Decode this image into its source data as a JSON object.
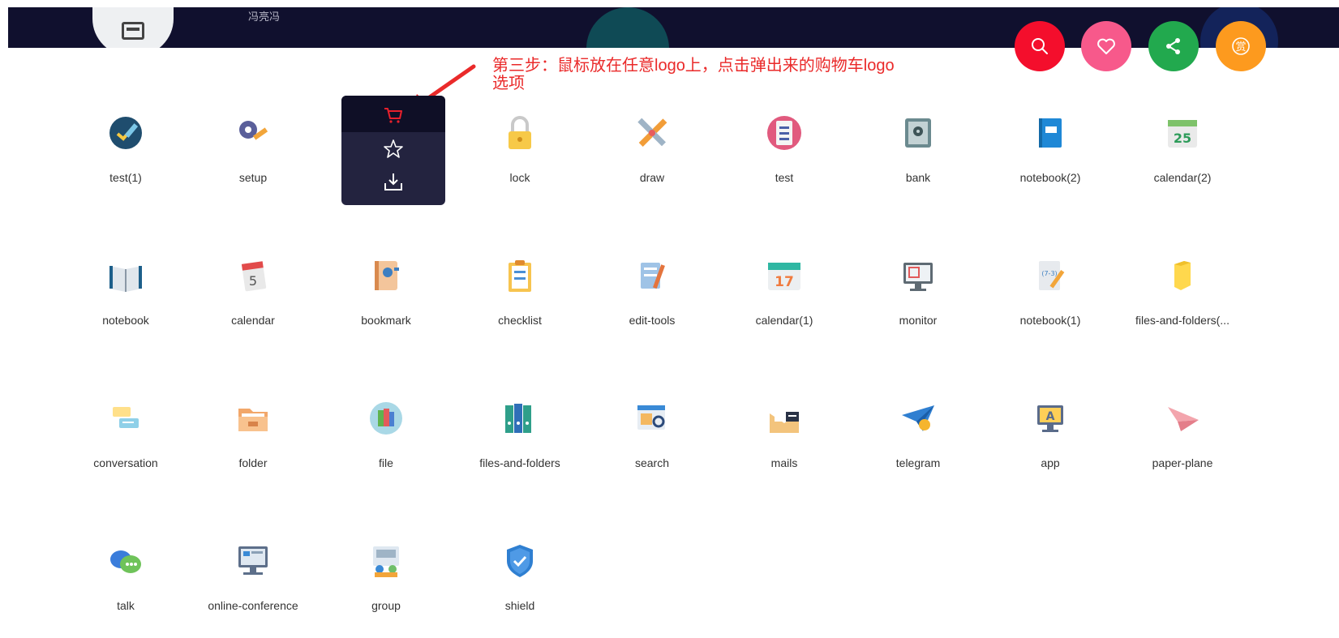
{
  "header": {
    "username": "冯亮冯"
  },
  "actions": [
    {
      "name": "search",
      "icon": "search-icon",
      "color": "#f40e2c"
    },
    {
      "name": "favorite",
      "icon": "heart-icon",
      "color": "#f7598b"
    },
    {
      "name": "share",
      "icon": "share-icon",
      "color": "#22a94e"
    },
    {
      "name": "reward",
      "icon": "reward-icon",
      "label": "赏",
      "color": "#fd9a1e"
    }
  ],
  "annotation": {
    "line1": "第三步：鼠标放在任意logo上，点击弹出来的购物车logo",
    "line2": "选项"
  },
  "hover_popup": {
    "buttons": [
      "cart-icon",
      "star-icon",
      "download-icon"
    ],
    "active_color": "#e8202c"
  },
  "icons": [
    {
      "label": "test(1)",
      "art": "test-check"
    },
    {
      "label": "setup",
      "art": "setup-gear"
    },
    {
      "label": "",
      "art": "hidden-by-popup"
    },
    {
      "label": "lock",
      "art": "lock"
    },
    {
      "label": "draw",
      "art": "draw-tools"
    },
    {
      "label": "test",
      "art": "test-clipboard"
    },
    {
      "label": "bank",
      "art": "bank-safe"
    },
    {
      "label": "notebook(2)",
      "art": "notebook-blue"
    },
    {
      "label": "calendar(2)",
      "art": "calendar-25"
    },
    {
      "label": "notebook",
      "art": "notebook-open"
    },
    {
      "label": "calendar",
      "art": "calendar-5"
    },
    {
      "label": "bookmark",
      "art": "bookmark-book"
    },
    {
      "label": "checklist",
      "art": "checklist"
    },
    {
      "label": "edit-tools",
      "art": "edit-tools"
    },
    {
      "label": "calendar(1)",
      "art": "calendar-17"
    },
    {
      "label": "monitor",
      "art": "monitor"
    },
    {
      "label": "notebook(1)",
      "art": "notebook-pencil"
    },
    {
      "label": "files-and-folders(...",
      "art": "folder-yellow"
    },
    {
      "label": "conversation",
      "art": "conversation"
    },
    {
      "label": "folder",
      "art": "folder-open"
    },
    {
      "label": "file",
      "art": "file-circle"
    },
    {
      "label": "files-and-folders",
      "art": "binders"
    },
    {
      "label": "search",
      "art": "search-window"
    },
    {
      "label": "mails",
      "art": "mails"
    },
    {
      "label": "telegram",
      "art": "telegram"
    },
    {
      "label": "app",
      "art": "app-monitor"
    },
    {
      "label": "paper-plane",
      "art": "paper-plane"
    },
    {
      "label": "talk",
      "art": "talk-bubbles"
    },
    {
      "label": "online-conference",
      "art": "online-conference"
    },
    {
      "label": "group",
      "art": "group"
    },
    {
      "label": "shield",
      "art": "shield"
    }
  ]
}
